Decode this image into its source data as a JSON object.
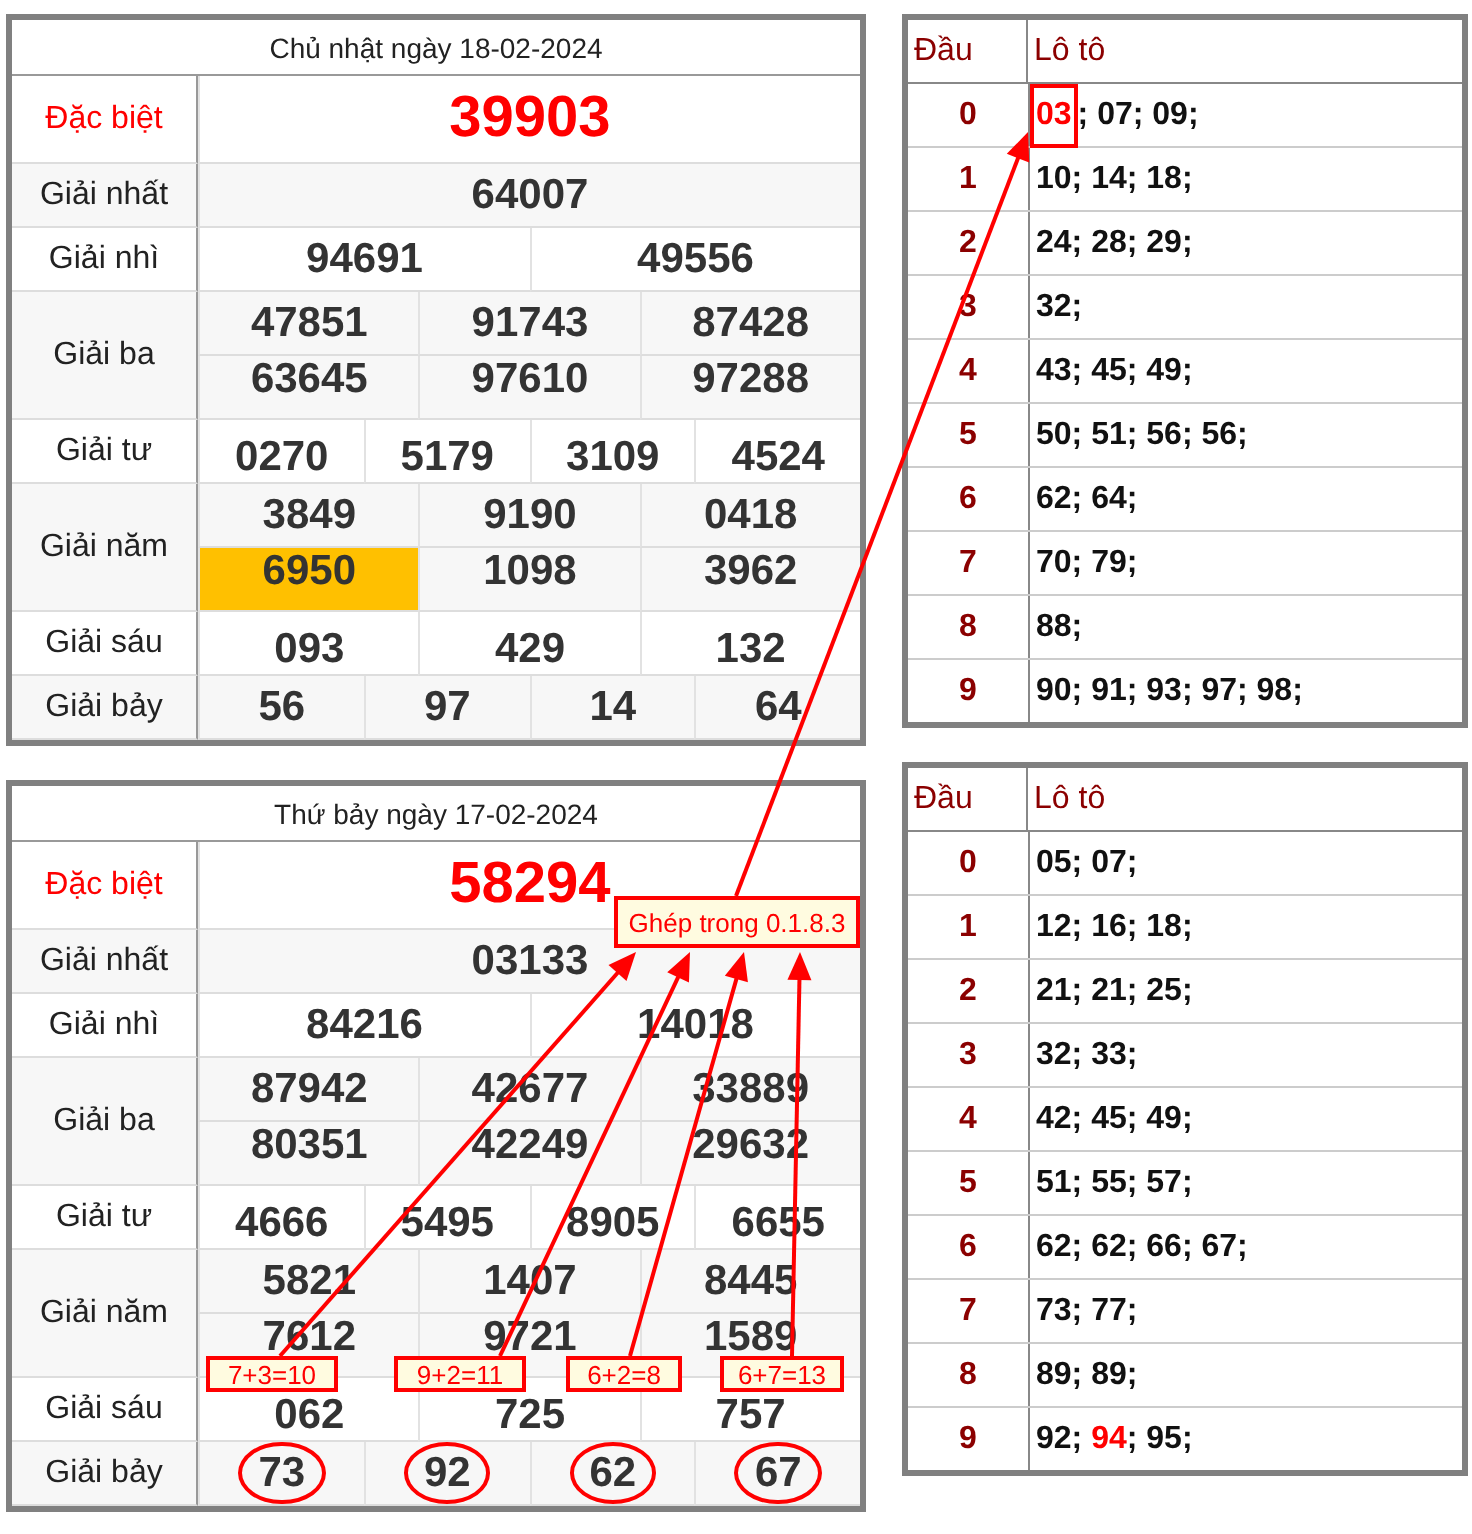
{
  "left_tables": [
    {
      "title": "Chủ nhật ngày 18-02-2024",
      "prizes": [
        {
          "label": "Đặc biệt",
          "kind": "special",
          "circled": false,
          "rows": [
            [
              {
                "value": "39903",
                "highlighted": false
              }
            ]
          ]
        },
        {
          "label": "Giải nhất",
          "kind": "normal",
          "circled": false,
          "rows": [
            [
              {
                "value": "64007",
                "highlighted": false
              }
            ]
          ]
        },
        {
          "label": "Giải nhì",
          "kind": "normal",
          "circled": false,
          "rows": [
            [
              {
                "value": "94691",
                "highlighted": false
              },
              {
                "value": "49556",
                "highlighted": false
              }
            ]
          ]
        },
        {
          "label": "Giải ba",
          "kind": "normal",
          "circled": false,
          "rows": [
            [
              {
                "value": "47851",
                "highlighted": false
              },
              {
                "value": "91743",
                "highlighted": false
              },
              {
                "value": "87428",
                "highlighted": false
              }
            ],
            [
              {
                "value": "63645",
                "highlighted": false
              },
              {
                "value": "97610",
                "highlighted": false
              },
              {
                "value": "97288",
                "highlighted": false
              }
            ]
          ]
        },
        {
          "label": "Giải tư",
          "kind": "normal",
          "circled": false,
          "rows": [
            [
              {
                "value": "0270",
                "highlighted": false
              },
              {
                "value": "5179",
                "highlighted": false
              },
              {
                "value": "3109",
                "highlighted": false
              },
              {
                "value": "4524",
                "highlighted": false
              }
            ]
          ]
        },
        {
          "label": "Giải năm",
          "kind": "normal",
          "circled": false,
          "rows": [
            [
              {
                "value": "3849",
                "highlighted": false
              },
              {
                "value": "9190",
                "highlighted": false
              },
              {
                "value": "0418",
                "highlighted": false
              }
            ],
            [
              {
                "value": "6950",
                "highlighted": true
              },
              {
                "value": "1098",
                "highlighted": false
              },
              {
                "value": "3962",
                "highlighted": false
              }
            ]
          ]
        },
        {
          "label": "Giải sáu",
          "kind": "normal",
          "circled": false,
          "rows": [
            [
              {
                "value": "093",
                "highlighted": false
              },
              {
                "value": "429",
                "highlighted": false
              },
              {
                "value": "132",
                "highlighted": false
              }
            ]
          ]
        },
        {
          "label": "Giải bảy",
          "kind": "normal",
          "circled": false,
          "rows": [
            [
              {
                "value": "56",
                "highlighted": false
              },
              {
                "value": "97",
                "highlighted": false
              },
              {
                "value": "14",
                "highlighted": false
              },
              {
                "value": "64",
                "highlighted": false
              }
            ]
          ]
        }
      ]
    },
    {
      "title": "Thứ bảy ngày 17-02-2024",
      "prizes": [
        {
          "label": "Đặc biệt",
          "kind": "special",
          "circled": false,
          "rows": [
            [
              {
                "value": "58294",
                "highlighted": false
              }
            ]
          ]
        },
        {
          "label": "Giải nhất",
          "kind": "normal",
          "circled": false,
          "rows": [
            [
              {
                "value": "03133",
                "highlighted": false
              }
            ]
          ]
        },
        {
          "label": "Giải nhì",
          "kind": "normal",
          "circled": false,
          "rows": [
            [
              {
                "value": "84216",
                "highlighted": false
              },
              {
                "value": "14018",
                "highlighted": false
              }
            ]
          ]
        },
        {
          "label": "Giải ba",
          "kind": "normal",
          "circled": false,
          "rows": [
            [
              {
                "value": "87942",
                "highlighted": false
              },
              {
                "value": "42677",
                "highlighted": false
              },
              {
                "value": "33889",
                "highlighted": false
              }
            ],
            [
              {
                "value": "80351",
                "highlighted": false
              },
              {
                "value": "42249",
                "highlighted": false
              },
              {
                "value": "29632",
                "highlighted": false
              }
            ]
          ]
        },
        {
          "label": "Giải tư",
          "kind": "normal",
          "circled": false,
          "rows": [
            [
              {
                "value": "4666",
                "highlighted": false
              },
              {
                "value": "5495",
                "highlighted": false
              },
              {
                "value": "8905",
                "highlighted": false
              },
              {
                "value": "6655",
                "highlighted": false
              }
            ]
          ]
        },
        {
          "label": "Giải năm",
          "kind": "normal",
          "circled": false,
          "rows": [
            [
              {
                "value": "5821",
                "highlighted": false
              },
              {
                "value": "1407",
                "highlighted": false
              },
              {
                "value": "8445",
                "highlighted": false
              }
            ],
            [
              {
                "value": "7612",
                "highlighted": false
              },
              {
                "value": "9721",
                "highlighted": false
              },
              {
                "value": "1589",
                "highlighted": false
              }
            ]
          ]
        },
        {
          "label": "Giải sáu",
          "kind": "normal",
          "circled": false,
          "rows": [
            [
              {
                "value": "062",
                "highlighted": false
              },
              {
                "value": "725",
                "highlighted": false
              },
              {
                "value": "757",
                "highlighted": false
              }
            ]
          ]
        },
        {
          "label": "Giải bảy",
          "kind": "normal",
          "circled": true,
          "rows": [
            [
              {
                "value": "73",
                "highlighted": false
              },
              {
                "value": "92",
                "highlighted": false
              },
              {
                "value": "62",
                "highlighted": false
              },
              {
                "value": "67",
                "highlighted": false
              }
            ]
          ]
        }
      ]
    }
  ],
  "loto_tables": [
    {
      "header": [
        "Đầu",
        "Lô tô"
      ],
      "rows": [
        {
          "head": "0",
          "segments": [
            {
              "text": "03",
              "highlighted": true,
              "boxed": true
            },
            {
              "text": "; 07; 09;",
              "highlighted": false,
              "boxed": false
            }
          ]
        },
        {
          "head": "1",
          "segments": [
            {
              "text": "10; 14; 18;",
              "highlighted": false,
              "boxed": false
            }
          ]
        },
        {
          "head": "2",
          "segments": [
            {
              "text": "24; 28; 29;",
              "highlighted": false,
              "boxed": false
            }
          ]
        },
        {
          "head": "3",
          "segments": [
            {
              "text": "32;",
              "highlighted": false,
              "boxed": false
            }
          ]
        },
        {
          "head": "4",
          "segments": [
            {
              "text": "43; 45; 49;",
              "highlighted": false,
              "boxed": false
            }
          ]
        },
        {
          "head": "5",
          "segments": [
            {
              "text": "50; 51; 56; 56;",
              "highlighted": false,
              "boxed": false
            }
          ]
        },
        {
          "head": "6",
          "segments": [
            {
              "text": "62; 64;",
              "highlighted": false,
              "boxed": false
            }
          ]
        },
        {
          "head": "7",
          "segments": [
            {
              "text": "70; 79;",
              "highlighted": false,
              "boxed": false
            }
          ]
        },
        {
          "head": "8",
          "segments": [
            {
              "text": "88;",
              "highlighted": false,
              "boxed": false
            }
          ]
        },
        {
          "head": "9",
          "segments": [
            {
              "text": "90; 91; 93; 97; 98;",
              "highlighted": false,
              "boxed": false
            }
          ]
        }
      ]
    },
    {
      "header": [
        "Đầu",
        "Lô tô"
      ],
      "rows": [
        {
          "head": "0",
          "segments": [
            {
              "text": "05; 07;",
              "highlighted": false,
              "boxed": false
            }
          ]
        },
        {
          "head": "1",
          "segments": [
            {
              "text": "12; 16; 18;",
              "highlighted": false,
              "boxed": false
            }
          ]
        },
        {
          "head": "2",
          "segments": [
            {
              "text": "21; 21; 25;",
              "highlighted": false,
              "boxed": false
            }
          ]
        },
        {
          "head": "3",
          "segments": [
            {
              "text": "32; 33;",
              "highlighted": false,
              "boxed": false
            }
          ]
        },
        {
          "head": "4",
          "segments": [
            {
              "text": "42; 45; 49;",
              "highlighted": false,
              "boxed": false
            }
          ]
        },
        {
          "head": "5",
          "segments": [
            {
              "text": "51; 55; 57;",
              "highlighted": false,
              "boxed": false
            }
          ]
        },
        {
          "head": "6",
          "segments": [
            {
              "text": "62; 62; 66; 67;",
              "highlighted": false,
              "boxed": false
            }
          ]
        },
        {
          "head": "7",
          "segments": [
            {
              "text": "73; 77;",
              "highlighted": false,
              "boxed": false
            }
          ]
        },
        {
          "head": "8",
          "segments": [
            {
              "text": "89; 89;",
              "highlighted": false,
              "boxed": false
            }
          ]
        },
        {
          "head": "9",
          "segments": [
            {
              "text": "92; ",
              "highlighted": false,
              "boxed": false
            },
            {
              "text": "94",
              "highlighted": true,
              "boxed": false
            },
            {
              "text": "; 95;",
              "highlighted": false,
              "boxed": false
            }
          ]
        }
      ]
    }
  ],
  "annotations": {
    "callout": "Ghép trong 0.1.8.3",
    "sums": [
      "7+3=10",
      "9+2=11",
      "6+2=8",
      "6+7=13"
    ]
  }
}
